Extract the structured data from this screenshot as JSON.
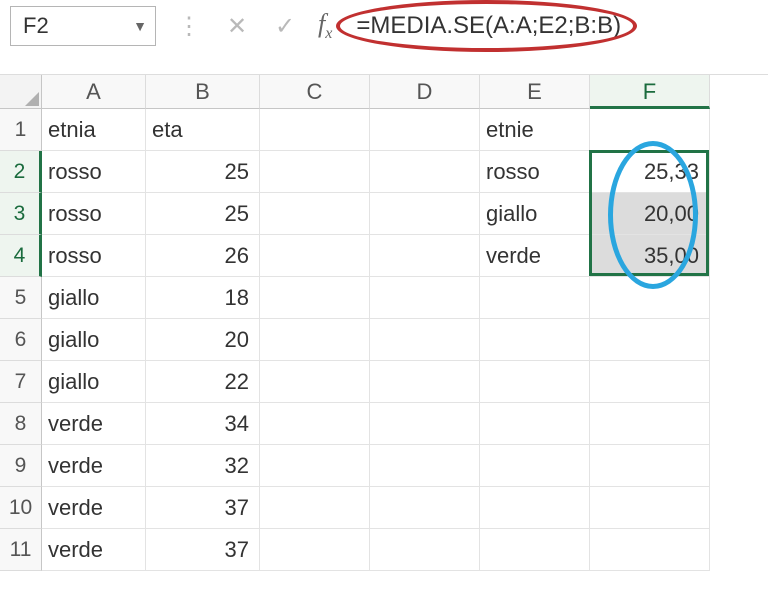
{
  "namebox": {
    "value": "F2"
  },
  "formula": "=MEDIA.SE(A:A;E2;B:B)",
  "columns": [
    "A",
    "B",
    "C",
    "D",
    "E",
    "F"
  ],
  "selected_col": "F",
  "selected_rows": [
    2,
    3,
    4
  ],
  "rows": [
    {
      "n": 1,
      "A": "etnia",
      "B": "eta",
      "C": "",
      "D": "",
      "E": "etnie",
      "F": ""
    },
    {
      "n": 2,
      "A": "rosso",
      "B": "25",
      "C": "",
      "D": "",
      "E": "rosso",
      "F": "25,33"
    },
    {
      "n": 3,
      "A": "rosso",
      "B": "25",
      "C": "",
      "D": "",
      "E": "giallo",
      "F": "20,00"
    },
    {
      "n": 4,
      "A": "rosso",
      "B": "26",
      "C": "",
      "D": "",
      "E": "verde",
      "F": "35,00"
    },
    {
      "n": 5,
      "A": "giallo",
      "B": "18",
      "C": "",
      "D": "",
      "E": "",
      "F": ""
    },
    {
      "n": 6,
      "A": "giallo",
      "B": "20",
      "C": "",
      "D": "",
      "E": "",
      "F": ""
    },
    {
      "n": 7,
      "A": "giallo",
      "B": "22",
      "C": "",
      "D": "",
      "E": "",
      "F": ""
    },
    {
      "n": 8,
      "A": "verde",
      "B": "34",
      "C": "",
      "D": "",
      "E": "",
      "F": ""
    },
    {
      "n": 9,
      "A": "verde",
      "B": "32",
      "C": "",
      "D": "",
      "E": "",
      "F": ""
    },
    {
      "n": 10,
      "A": "verde",
      "B": "37",
      "C": "",
      "D": "",
      "E": "",
      "F": ""
    },
    {
      "n": 11,
      "A": "verde",
      "B": "37",
      "C": "",
      "D": "",
      "E": "",
      "F": ""
    }
  ],
  "annotation_colors": {
    "red_oval": "#c13030",
    "blue_oval": "#2aa6df"
  }
}
